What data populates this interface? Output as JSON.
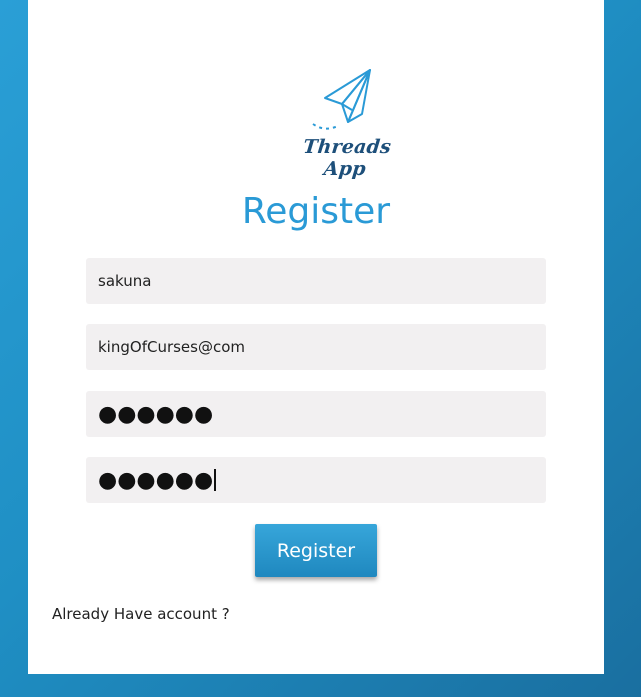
{
  "app": {
    "logo_text": "Threads App",
    "logo_icon": "paper-plane-icon"
  },
  "form": {
    "title": "Register",
    "username_value": "sakuna",
    "email_value": "kingOfCurses@com",
    "password_mask": "●●●●●●",
    "confirm_password_mask": "●●●●●●",
    "submit_label": "Register"
  },
  "footer": {
    "login_link_text": "Already Have account ?"
  },
  "colors": {
    "background": "#2a9fd6",
    "accent": "#2a9ad6",
    "logo_text": "#1d4f7a",
    "field_bg": "#f2f0f1"
  }
}
